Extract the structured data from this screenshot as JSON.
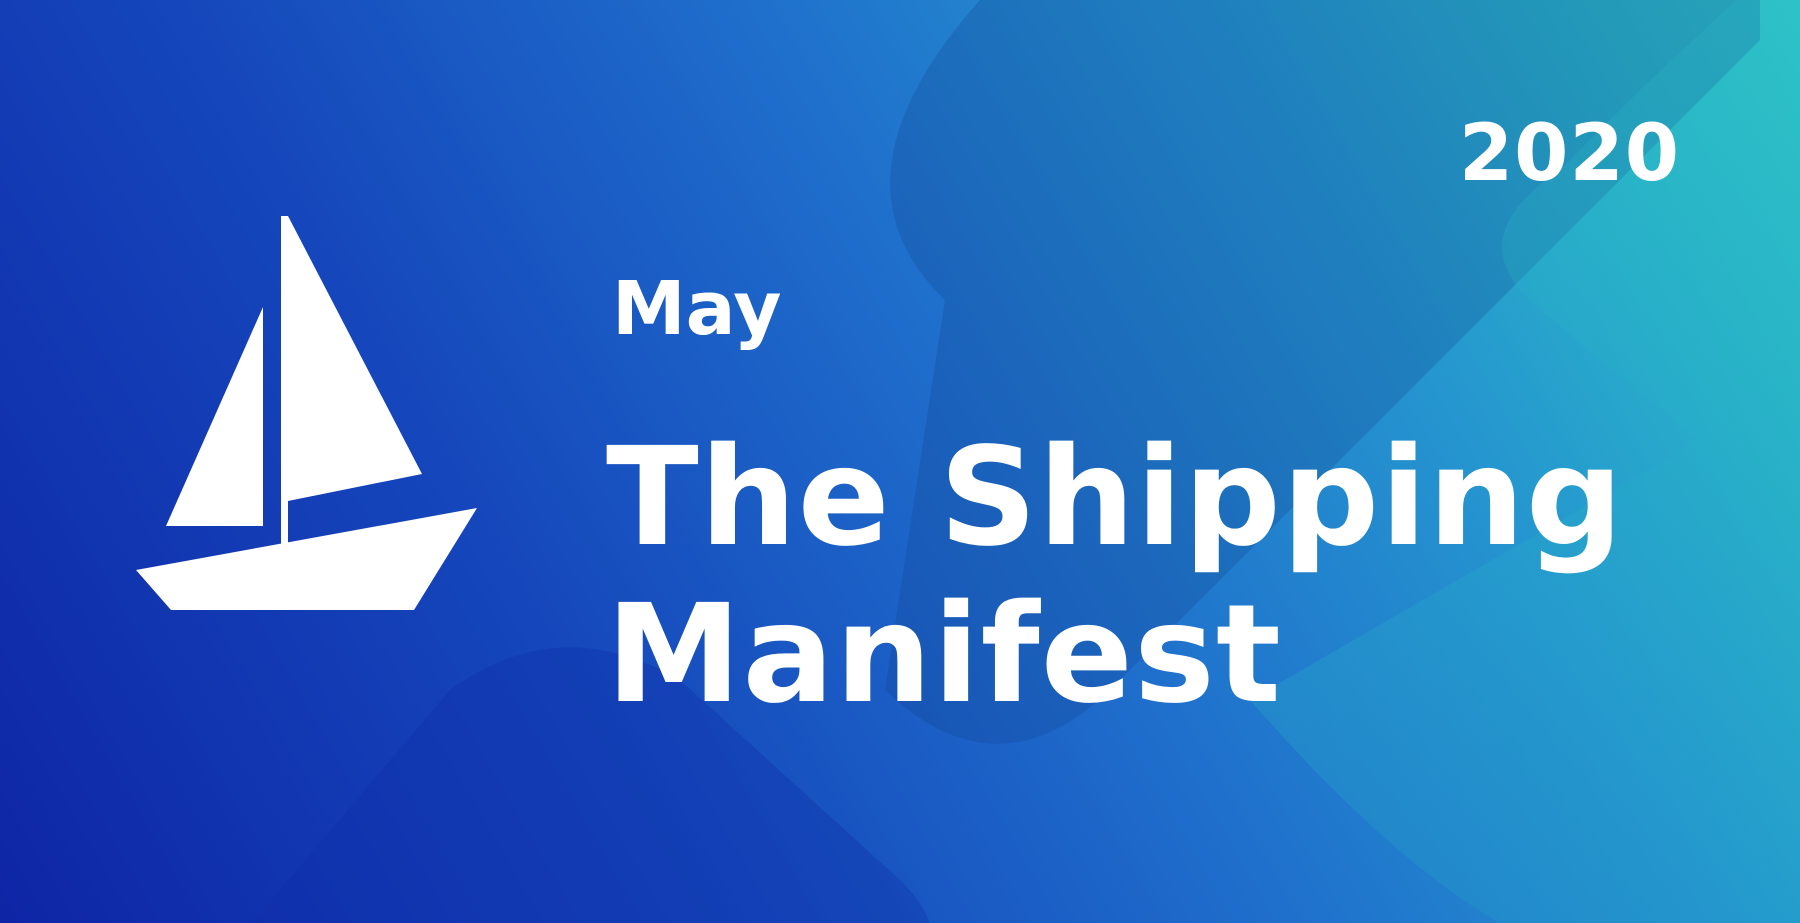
{
  "banner": {
    "year": "2020",
    "month": "May",
    "title_line1": "The Shipping",
    "title_line2": "Manifest"
  },
  "logo": {
    "icon": "sailboat-icon",
    "color": "#ffffff"
  },
  "colors": {
    "gradient_start": "#0e25a6",
    "gradient_mid": "#1f6fcc",
    "gradient_end": "#30c6c8",
    "text": "#ffffff"
  }
}
